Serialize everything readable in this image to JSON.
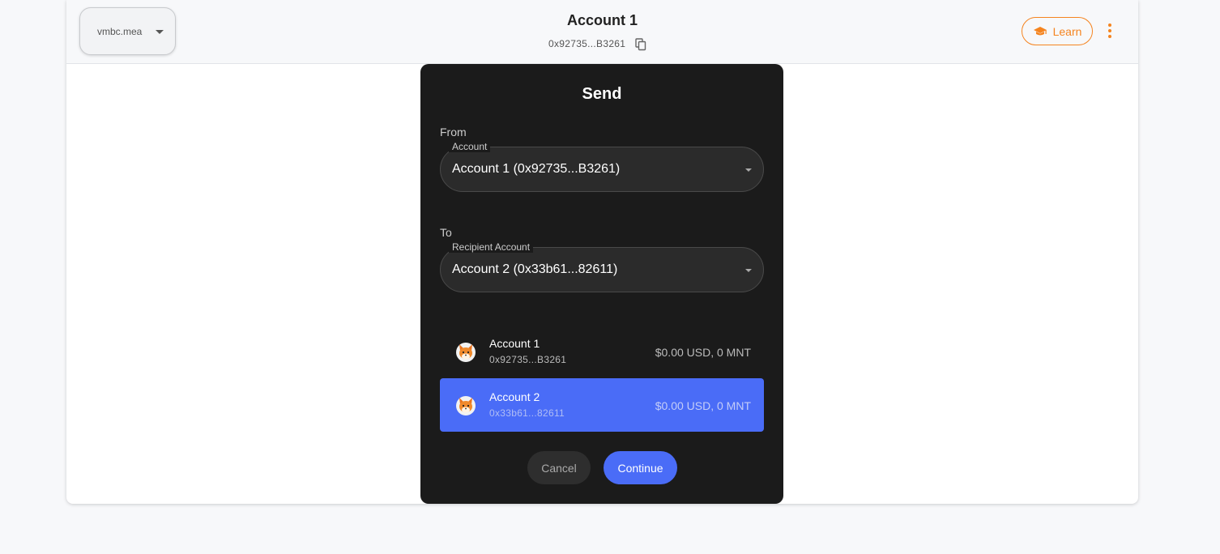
{
  "header": {
    "network_label": "vmbc.mea",
    "account_title": "Account 1",
    "account_address": "0x92735...B3261",
    "learn_label": "Learn"
  },
  "modal": {
    "title": "Send",
    "from_label": "From",
    "from_select": {
      "legend": "Account",
      "value": "Account 1 (0x92735...B3261)"
    },
    "to_label": "To",
    "to_select": {
      "legend": "Recipient Account",
      "value": "Account 2 (0x33b61...82611)"
    },
    "accounts": [
      {
        "name": "Account 1",
        "address": "0x92735...B3261",
        "balance": "$0.00 USD, 0 MNT",
        "selected": false
      },
      {
        "name": "Account 2",
        "address": "0x33b61...82611",
        "balance": "$0.00 USD, 0 MNT",
        "selected": true
      }
    ],
    "cancel_label": "Cancel",
    "continue_label": "Continue"
  },
  "icons": {
    "copy": "copy-icon",
    "learn": "graduation-cap-icon",
    "menu": "kebab-menu-icon",
    "avatar": "fox-avatar-icon"
  },
  "colors": {
    "accent_orange": "#f5841f",
    "accent_blue": "#4a6cf7",
    "modal_bg": "#1b1b1b"
  }
}
